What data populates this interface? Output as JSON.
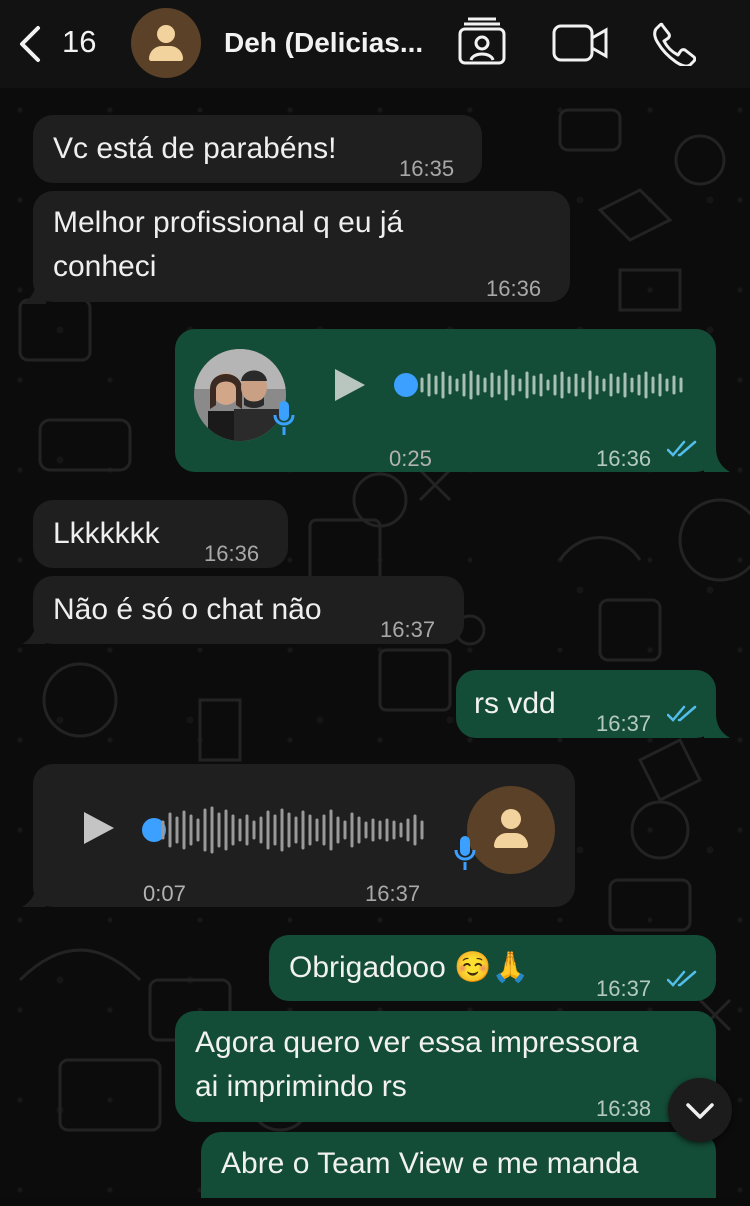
{
  "header": {
    "back_count": "16",
    "contact_name": "Deh (Delicias...",
    "icons": [
      "chevron-left-icon",
      "avatar-placeholder-icon",
      "contact-card-icon",
      "video-call-icon",
      "phone-call-icon"
    ]
  },
  "messages": [
    {
      "direction": "in",
      "text": "Vc está de parabéns!",
      "time": "16:35"
    },
    {
      "direction": "in",
      "text_lines": [
        "Melhor profissional q eu já",
        "conheci"
      ],
      "time": "16:36"
    },
    {
      "direction": "out",
      "type": "voice",
      "duration": "0:25",
      "time": "16:36",
      "status": "read"
    },
    {
      "direction": "in",
      "text": "Lkkkkkk",
      "time": "16:36"
    },
    {
      "direction": "in",
      "text": "Não é só o chat não",
      "time": "16:37"
    },
    {
      "direction": "out",
      "text": "rs vdd",
      "time": "16:37",
      "status": "read"
    },
    {
      "direction": "in",
      "type": "voice",
      "duration": "0:07",
      "time": "16:37"
    },
    {
      "direction": "out",
      "text": "Obrigadooo ☺️🙏",
      "time": "16:37",
      "status": "read"
    },
    {
      "direction": "out",
      "text_lines": [
        "Agora quero ver essa impressora",
        "ai imprimindo rs"
      ],
      "time": "16:38"
    },
    {
      "direction": "out",
      "text": "Abre o Team View e me manda",
      "time": ""
    }
  ],
  "colors": {
    "incoming_bubble": "#1f1f1f",
    "outgoing_bubble": "#144d37",
    "read_ticks": "#53bdeb",
    "voice_dot": "#3ba0ff"
  }
}
